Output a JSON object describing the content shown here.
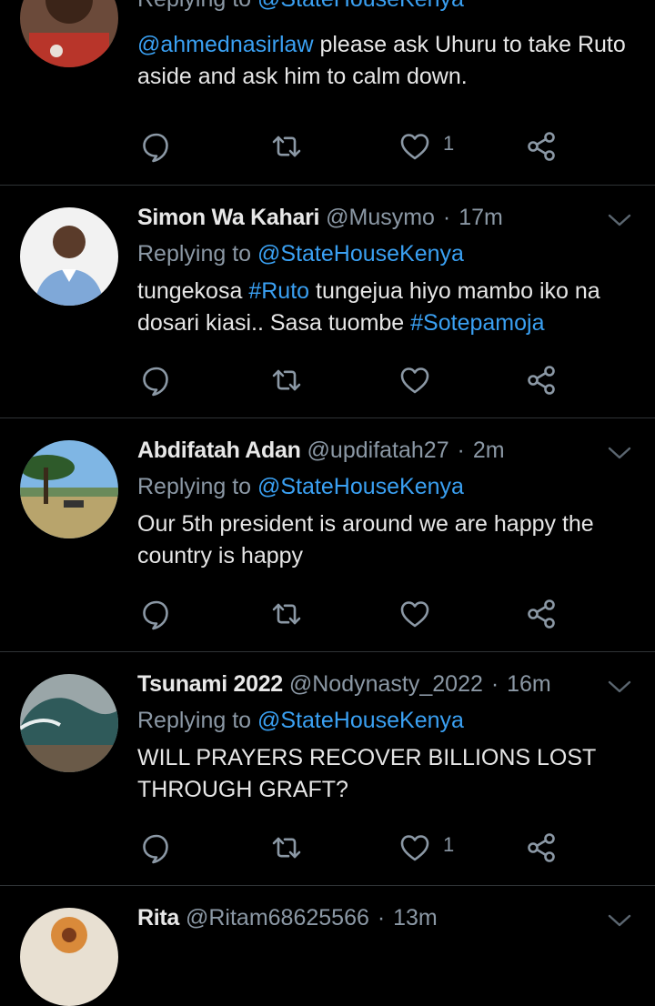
{
  "colors": {
    "background": "#000000",
    "accent": "#3aa0f2",
    "muted": "#8b98a5",
    "text": "#e6e6e6",
    "divider": "#2f3336"
  },
  "tweets": [
    {
      "reply_prefix": "Replying to",
      "reply_handle": "@StateHouseKenya",
      "mention": "@ahmednasirlaw",
      "body": " please ask Uhuru to take Ruto aside and ask him to calm down.",
      "like_count": "1"
    },
    {
      "name": "Simon Wa Kahari",
      "handle": "@Musymo",
      "time": "17m",
      "reply_prefix": "Replying to",
      "reply_handle": "@StateHouseKenya",
      "body_parts": [
        "tungekosa ",
        "#Ruto",
        " tungejua hiyo mambo iko na dosari kiasi.. Sasa tuombe ",
        "#Sotepamoja"
      ],
      "like_count": ""
    },
    {
      "name": "Abdifatah Adan",
      "handle": "@updifatah27",
      "time": "2m",
      "reply_prefix": "Replying to",
      "reply_handle": "@StateHouseKenya",
      "body": "Our 5th president is around we are happy the country is happy",
      "like_count": ""
    },
    {
      "name": "Tsunami 2022",
      "handle": "@Nodynasty_2022",
      "time": "16m",
      "reply_prefix": "Replying to",
      "reply_handle": "@StateHouseKenya",
      "body": "WILL PRAYERS RECOVER BILLIONS LOST THROUGH GRAFT?",
      "like_count": "1"
    },
    {
      "name": "Rita",
      "handle": "@Ritam68625566",
      "time": "13m"
    }
  ],
  "icons": [
    "reply-icon",
    "retweet-icon",
    "like-icon",
    "share-icon",
    "chevron-down-icon"
  ]
}
